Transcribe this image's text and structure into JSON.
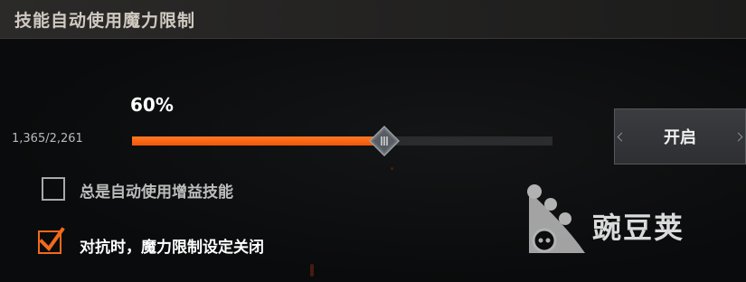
{
  "header": {
    "title": "技能自动使用魔力限制"
  },
  "slider": {
    "percent_label": "60%",
    "value_fraction": 0.6,
    "mana_label": "1,365/2,261"
  },
  "toggle": {
    "label": "开启"
  },
  "options": [
    {
      "label": "总是自动使用增益技能",
      "checked": false
    },
    {
      "label": "对抗时，魔力限制设定关闭",
      "checked": true
    }
  ],
  "watermark": {
    "text": "豌豆荚"
  },
  "colors": {
    "accent": "#f2560a",
    "track": "#2a2c2e",
    "header": "#2b2a29"
  }
}
